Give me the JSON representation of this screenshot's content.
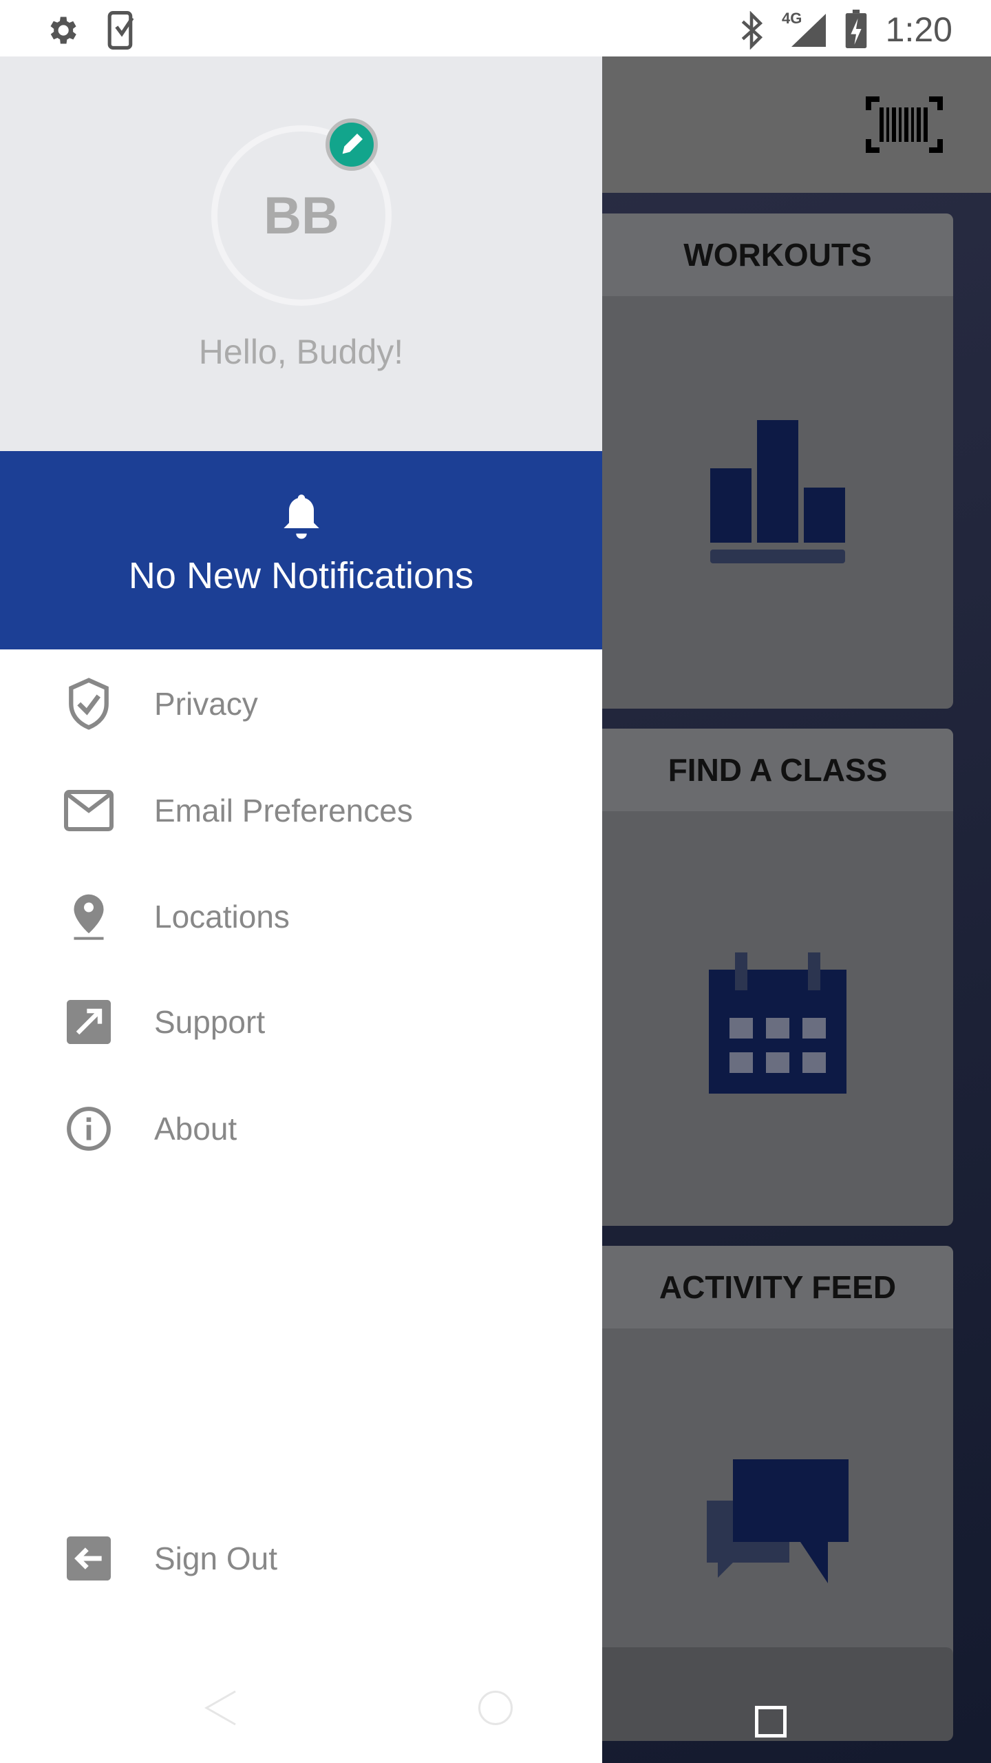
{
  "status_bar": {
    "time": "1:20",
    "network": "4G",
    "icons": [
      "gear-icon",
      "phone-check-icon",
      "bluetooth-icon",
      "signal-icon",
      "battery-charging-icon"
    ]
  },
  "drawer": {
    "avatar_initials": "BB",
    "greeting": "Hello, Buddy!",
    "notifications": "No New Notifications",
    "items": [
      {
        "label": "Privacy",
        "icon": "shield-check-icon"
      },
      {
        "label": "Email Preferences",
        "icon": "mail-icon"
      },
      {
        "label": "Locations",
        "icon": "location-pin-icon"
      },
      {
        "label": "Support",
        "icon": "external-link-icon"
      },
      {
        "label": "About",
        "icon": "info-icon"
      }
    ],
    "sign_out": "Sign Out"
  },
  "main": {
    "cards": [
      {
        "title": "WORKOUTS"
      },
      {
        "title": "FIND A CLASS"
      },
      {
        "title": "ACTIVITY FEED"
      }
    ]
  },
  "colors": {
    "accent": "#1c3f95",
    "edit": "#12a58c",
    "icon_navy": "#0d1a45"
  }
}
